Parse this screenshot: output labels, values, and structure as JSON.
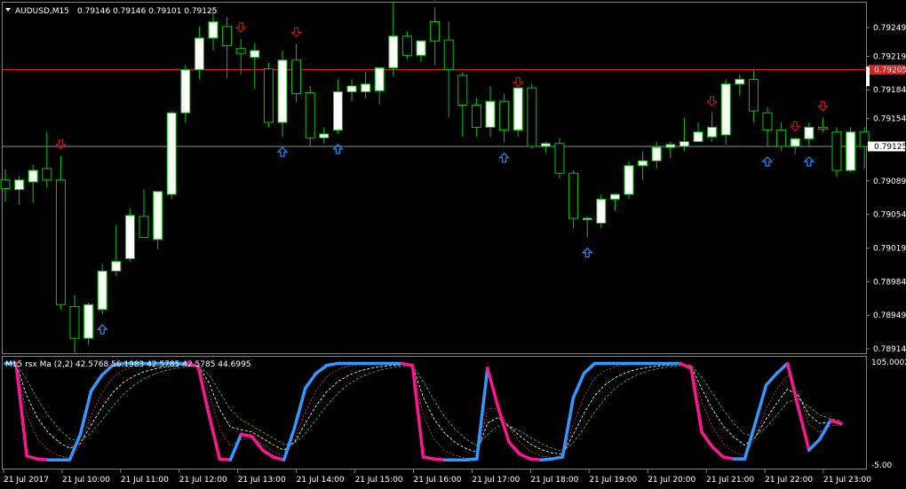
{
  "title": {
    "symbol_tf": "AUDUSD,M15",
    "ohlc": "0.79146 0.79146 0.79101 0.79125"
  },
  "price_axis": {
    "labels": [
      "0.79249",
      "0.79219",
      "0.79184",
      "0.79154",
      "0.79125",
      "0.79089",
      "0.79054",
      "0.79019",
      "0.78984",
      "0.78949",
      "0.78914"
    ],
    "current_price": "0.79125",
    "red_level": "0.79205"
  },
  "indicator": {
    "label": "M15 rsx Ma (2,2) 42.5768 56.1983 42.5785 42.5785 44.6995",
    "axis_top": "105.0002",
    "axis_bottom": "-5.00"
  },
  "time_axis": [
    "21 Jul 2017",
    "21 Jul 10:00",
    "21 Jul 11:00",
    "21 Jul 12:00",
    "21 Jul 13:00",
    "21 Jul 14:00",
    "21 Jul 15:00",
    "21 Jul 16:00",
    "21 Jul 17:00",
    "21 Jul 18:00",
    "21 Jul 19:00",
    "21 Jul 20:00",
    "21 Jul 21:00",
    "21 Jul 22:00",
    "21 Jul 23:00"
  ],
  "colors": {
    "background": "#000000",
    "grid": "#808080",
    "bull": "#ffffff",
    "wick": "#00c800",
    "sell_arrow": "#c81414",
    "buy_arrow": "#1e90ff",
    "red_line": "#dc1e1e",
    "rsx_up": "#3399ff",
    "rsx_down": "#ff1493",
    "sig_green": "#32cd32",
    "sig_pink": "#ff3399"
  },
  "chart_data": {
    "type": "candlestick",
    "series": [
      {
        "name": "AUDUSD,M15",
        "ohlc": [
          [
            0.7909,
            0.79101,
            0.79067,
            0.79081
          ],
          [
            0.7908,
            0.79094,
            0.79064,
            0.7909
          ],
          [
            0.79088,
            0.79106,
            0.79066,
            0.791
          ],
          [
            0.79102,
            0.7914,
            0.79082,
            0.7909
          ],
          [
            0.7909,
            0.79115,
            0.78955,
            0.7896
          ],
          [
            0.78958,
            0.7897,
            0.7891,
            0.78925
          ],
          [
            0.78925,
            0.78962,
            0.78918,
            0.7896
          ],
          [
            0.78955,
            0.79003,
            0.7895,
            0.78995
          ],
          [
            0.78995,
            0.79043,
            0.7899,
            0.79005
          ],
          [
            0.79008,
            0.7906,
            0.79005,
            0.79053
          ],
          [
            0.79052,
            0.7908,
            0.7903,
            0.7903
          ],
          [
            0.79028,
            0.79075,
            0.79018,
            0.79078
          ],
          [
            0.79075,
            0.79162,
            0.7907,
            0.7916
          ],
          [
            0.7916,
            0.7921,
            0.7915,
            0.79205
          ],
          [
            0.79205,
            0.7925,
            0.79195,
            0.79238
          ],
          [
            0.79238,
            0.7927,
            0.79225,
            0.79255
          ],
          [
            0.7925,
            0.7926,
            0.79196,
            0.7923
          ],
          [
            0.79227,
            0.79237,
            0.792,
            0.79222
          ],
          [
            0.79218,
            0.79233,
            0.79185,
            0.79225
          ],
          [
            0.79206,
            0.79212,
            0.79145,
            0.7915
          ],
          [
            0.7915,
            0.79225,
            0.79135,
            0.79215
          ],
          [
            0.79215,
            0.79232,
            0.79171,
            0.7918
          ],
          [
            0.79181,
            0.79188,
            0.79125,
            0.79134
          ],
          [
            0.79134,
            0.79145,
            0.79128,
            0.79138
          ],
          [
            0.79142,
            0.79195,
            0.79138,
            0.79182
          ],
          [
            0.79182,
            0.79195,
            0.79172,
            0.79188
          ],
          [
            0.79182,
            0.79203,
            0.79175,
            0.7919
          ],
          [
            0.79183,
            0.792,
            0.79169,
            0.79207
          ],
          [
            0.79207,
            0.79275,
            0.79198,
            0.7924
          ],
          [
            0.7924,
            0.79245,
            0.79216,
            0.7922
          ],
          [
            0.7922,
            0.7923,
            0.79213,
            0.79235
          ],
          [
            0.79255,
            0.7927,
            0.7921,
            0.79235
          ],
          [
            0.79236,
            0.79255,
            0.79155,
            0.79205
          ],
          [
            0.79199,
            0.79203,
            0.79135,
            0.79168
          ],
          [
            0.79168,
            0.79176,
            0.79135,
            0.79145
          ],
          [
            0.79145,
            0.79188,
            0.79135,
            0.79172
          ],
          [
            0.79172,
            0.7918,
            0.79129,
            0.79142
          ],
          [
            0.79142,
            0.7918,
            0.79135,
            0.79186
          ],
          [
            0.79186,
            0.7919,
            0.79123,
            0.79125
          ],
          [
            0.79125,
            0.7913,
            0.79118,
            0.79128
          ],
          [
            0.79128,
            0.79134,
            0.79092,
            0.79097
          ],
          [
            0.79097,
            0.791,
            0.7904,
            0.7905
          ],
          [
            0.7905,
            0.79052,
            0.7903,
            0.7905
          ],
          [
            0.79045,
            0.79075,
            0.7904,
            0.7907
          ],
          [
            0.7907,
            0.79075,
            0.79058,
            0.79075
          ],
          [
            0.79075,
            0.7911,
            0.7907,
            0.79105
          ],
          [
            0.79105,
            0.7912,
            0.7909,
            0.7911
          ],
          [
            0.7911,
            0.7913,
            0.79102,
            0.79124
          ],
          [
            0.79124,
            0.7913,
            0.79113,
            0.79127
          ],
          [
            0.79125,
            0.79155,
            0.7912,
            0.7913
          ],
          [
            0.7913,
            0.7915,
            0.7913,
            0.7914
          ],
          [
            0.79135,
            0.7916,
            0.7913,
            0.79145
          ],
          [
            0.79137,
            0.79195,
            0.79127,
            0.7919
          ],
          [
            0.7919,
            0.792,
            0.79178,
            0.79195
          ],
          [
            0.79195,
            0.79205,
            0.7915,
            0.79162
          ],
          [
            0.7916,
            0.79166,
            0.79125,
            0.79142
          ],
          [
            0.79142,
            0.7915,
            0.7912,
            0.79125
          ],
          [
            0.79125,
            0.79134,
            0.79117,
            0.79133
          ],
          [
            0.79133,
            0.7915,
            0.79125,
            0.79145
          ],
          [
            0.79145,
            0.79155,
            0.7914,
            0.79143
          ],
          [
            0.7914,
            0.79145,
            0.79093,
            0.791
          ],
          [
            0.791,
            0.79145,
            0.79098,
            0.7914
          ],
          [
            0.7914,
            0.79145,
            0.79102,
            0.79125
          ]
        ]
      },
      {
        "name": "rsx",
        "values": [
          100,
          100,
          6,
          3,
          2,
          2,
          2,
          28,
          72,
          88,
          98,
          100,
          100,
          100,
          100,
          100,
          100,
          100,
          97,
          48,
          3,
          2,
          28,
          26,
          12,
          5,
          2,
          35,
          75,
          90,
          98,
          100,
          100,
          100,
          100,
          100,
          100,
          100,
          98,
          5,
          3,
          2,
          2,
          2,
          3,
          95,
          55,
          20,
          8,
          3,
          2,
          3,
          5,
          65,
          90,
          100,
          100,
          100,
          100,
          100,
          100,
          100,
          100,
          100,
          95,
          30,
          15,
          5,
          3,
          3,
          40,
          78,
          90,
          100,
          55,
          12,
          23,
          42,
          39
        ]
      }
    ],
    "buy_arrows_at": [
      7,
      20,
      24,
      36,
      42,
      55,
      58
    ],
    "sell_arrows_at": [
      4,
      17,
      21,
      31,
      37,
      51,
      57,
      59
    ],
    "indicator_range": [
      -5,
      105.0002
    ]
  }
}
